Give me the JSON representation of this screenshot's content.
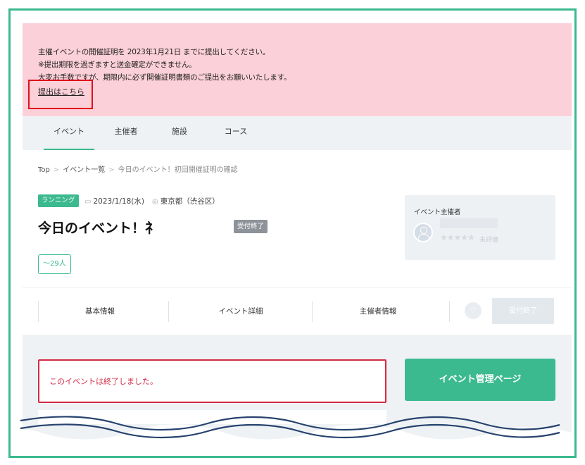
{
  "notice": {
    "line1": "主催イベントの開催証明を 2023年1月21日 までに提出してください。",
    "line2": "※提出期限を過ぎますと送金確定ができません。",
    "line3": "大変お手数ですが、期限内に必ず開催証明書類のご提出をお願いいたします。",
    "link": "提出はこちら"
  },
  "tabs": [
    {
      "label": "イベント",
      "active": true
    },
    {
      "label": "主催者"
    },
    {
      "label": "施設"
    },
    {
      "label": "コース"
    }
  ],
  "breadcrumb": [
    "Top",
    "イベント一覧",
    "今日のイベント！初回開催証明の確認"
  ],
  "event": {
    "category": "ランニング",
    "date": "2023/1/18(水)",
    "location": "東京都（渋谷区）",
    "title": "今日のイベント！礻",
    "status": "受付終了",
    "capacity": "〜29人"
  },
  "organizer": {
    "label": "イベント主催者",
    "stars": "★★★★★",
    "rating": "未評価"
  },
  "subnav": [
    "基本情報",
    "イベント詳細",
    "主催者情報"
  ],
  "actions": {
    "closed_label": "受付終了",
    "manage_label": "イベント管理ページ"
  },
  "ended_message": "このイベントは終了しました。",
  "colors": {
    "accent": "#3bb98f",
    "notice_bg": "#fcd0d8",
    "alert": "#d32a46",
    "highlight": "#e0101a"
  }
}
